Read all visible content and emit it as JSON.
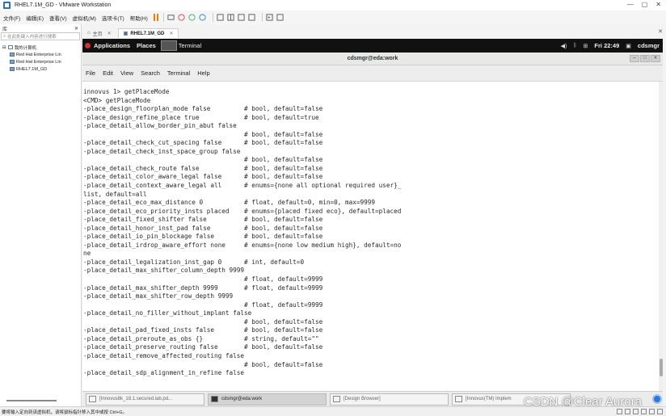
{
  "vmware": {
    "title": "RHEL7.1M_GD - VMware Workstation",
    "window_controls": [
      "—",
      "▢",
      "✕"
    ],
    "menu": [
      "文件(F)",
      "编辑(E)",
      "查看(V)",
      "虚拟机(M)",
      "选项卡(T)",
      "帮助(H)"
    ]
  },
  "library": {
    "title": "库",
    "close": "✕",
    "search_placeholder": "在此处键入内容进行搜索",
    "root": "我的计算机",
    "vms": [
      "Red Hat Enterprise Lin",
      "Red Hat Enterprise Lin",
      "RHEL7.1M_GD"
    ]
  },
  "tabs": [
    {
      "label": "主页",
      "active": false
    },
    {
      "label": "RHEL7.1M_GD",
      "active": true
    }
  ],
  "gnome": {
    "applications": "Applications",
    "places": "Places",
    "terminal": "Terminal",
    "clock": "Fri 22:49",
    "user": "cdsmgr",
    "icons": [
      "volume-icon",
      "bluetooth-icon",
      "network-icon",
      "user-icon"
    ]
  },
  "terminal": {
    "window_title": "cdsmgr@eda:work",
    "menu": [
      "File",
      "Edit",
      "View",
      "Search",
      "Terminal",
      "Help"
    ],
    "lines": [
      "innovus 1> getPlaceMode",
      "<CMD> getPlaceMode",
      "-place_design_floorplan_mode false         # bool, default=false",
      "-place_design_refine_place true            # bool, default=true",
      "-place_detail_allow_border_pin_abut false",
      "                                           # bool, default=false",
      "-place_detail_check_cut_spacing false      # bool, default=false",
      "-place_detail_check_inst_space_group false",
      "                                           # bool, default=false",
      "-place_detail_check_route false            # bool, default=false",
      "-place_detail_color_aware_legal false      # bool, default=false",
      "-place_detail_context_aware_legal all      # enums={none all optional required user}_",
      "list, default=all",
      "-place_detail_eco_max_distance 0           # float, default=0, min=0, max=9999",
      "-place_detail_eco_priority_insts placed    # enums={placed fixed eco}, default=placed",
      "-place_detail_fixed_shifter false          # bool, default=false",
      "-place_detail_honor_inst_pad false         # bool, default=false",
      "-place_detail_io_pin_blockage false        # bool, default=false",
      "-place_detail_irdrop_aware_effort none     # enums={none low medium high}, default=no",
      "ne",
      "-place_detail_legalization_inst_gap 0      # int, default=0",
      "-place_detail_max_shifter_column_depth 9999",
      "                                           # float, default=9999",
      "-place_detail_max_shifter_depth 9999       # float, default=9999",
      "-place_detail_max_shifter_row_depth 9999",
      "                                           # float, default=9999",
      "-place_detail_no_filler_without_implant false",
      "                                           # bool, default=false",
      "-place_detail_pad_fixed_insts false        # bool, default=false",
      "-place_detail_preroute_as_obs {}           # string, default=\"\"",
      "-place_detail_preserve_routing false       # bool, default=false",
      "-place_detail_remove_affected_routing false",
      "                                           # bool, default=false",
      "-place_detail_sdp_alignment_in_refine false"
    ]
  },
  "taskbar": [
    {
      "label": "[Innovus8k_18.1.secured.lab.pd...",
      "active": false
    },
    {
      "label": "cdsmgr@eda:work",
      "active": true
    },
    {
      "label": "[Design Browser]",
      "active": false
    },
    {
      "label": "[Innovus(TM) Implem",
      "active": false
    }
  ],
  "watermark": "CSDN @Clear Aurora",
  "status": "要将输入定向到该虚拟机，请将鼠标指针移入其中或按 Ctrl+G。"
}
